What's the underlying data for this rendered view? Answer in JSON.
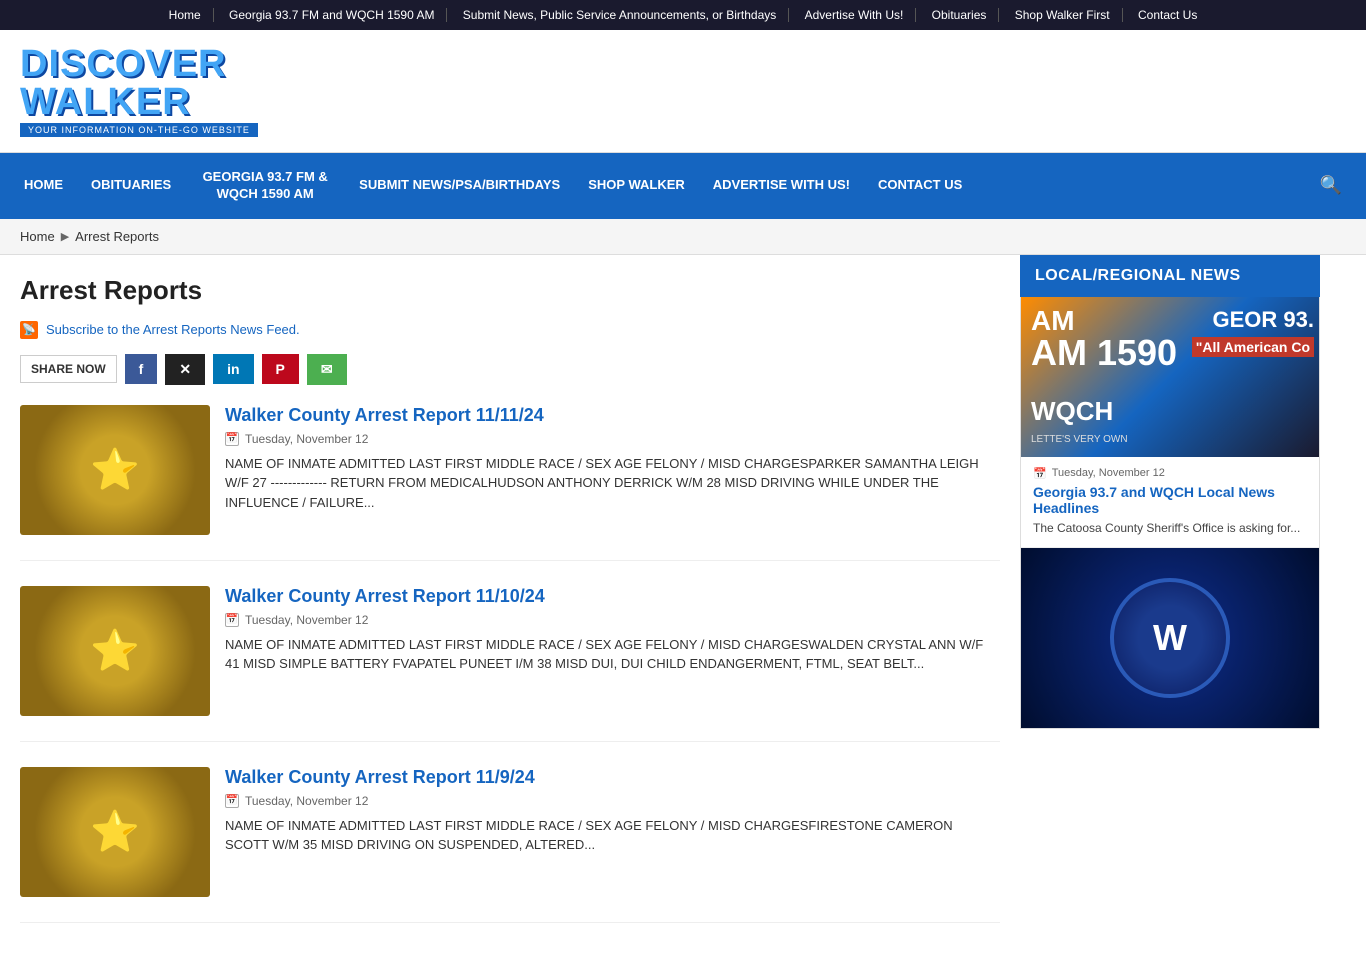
{
  "topnav": {
    "links": [
      {
        "label": "Home",
        "href": "#"
      },
      {
        "label": "Georgia 93.7 FM and WQCH 1590 AM",
        "href": "#"
      },
      {
        "label": "Submit News, Public Service Announcements, or Birthdays",
        "href": "#"
      },
      {
        "label": "Advertise With Us!",
        "href": "#"
      },
      {
        "label": "Obituaries",
        "href": "#"
      },
      {
        "label": "Shop Walker First",
        "href": "#"
      },
      {
        "label": "Contact Us",
        "href": "#"
      }
    ]
  },
  "header": {
    "logo_line1": "DISCOVER",
    "logo_line2": "WALKER",
    "subtitle": "YOUR INFORMATION ON-THE-GO WEBSITE"
  },
  "mainnav": {
    "items": [
      {
        "label": "HOME",
        "href": "#"
      },
      {
        "label": "OBITUARIES",
        "href": "#"
      },
      {
        "label": "GEORGIA 93.7 FM & WQCH 1590 AM",
        "href": "#"
      },
      {
        "label": "SUBMIT NEWS/PSA/BIRTHDAYS",
        "href": "#"
      },
      {
        "label": "SHOP WALKER",
        "href": "#"
      },
      {
        "label": "ADVERTISE WITH US!",
        "href": "#"
      },
      {
        "label": "CONTACT US",
        "href": "#"
      }
    ]
  },
  "breadcrumb": {
    "home": "Home",
    "current": "Arrest Reports"
  },
  "page": {
    "title": "Arrest Reports",
    "rss_text": "Subscribe to the Arrest Reports News Feed.",
    "share_label": "SHARE NOW"
  },
  "share": {
    "facebook": "f",
    "twitter": "✕",
    "linkedin": "in",
    "pinterest": "P",
    "email": "✉"
  },
  "articles": [
    {
      "title": "Walker County Arrest Report 11/11/24",
      "date": "Tuesday, November 12",
      "text": "NAME OF INMATE ADMITTED    LAST              FIRST                MIDDLE  RACE / SEX   AGE  FELONY / MISD    CHARGESPARKER  SAMANTHA  LEIGH  W/F  27  -------------    RETURN FROM MEDICALHUDSON  ANTHONY  DERRICK  W/M  28  MISD   DRIVING WHILE UNDER THE INFLUENCE / FAILURE..."
    },
    {
      "title": "Walker County Arrest Report 11/10/24",
      "date": "Tuesday, November 12",
      "text": "NAME OF INMATE ADMITTED    LAST              FIRST                MIDDLE  RACE / SEX   AGE  FELONY / MISD    CHARGESWALDEN  CRYSTAL  ANN  W/F  41  MISD    SIMPLE BATTERY  FVAPATEL  PUNEET    I/M  38  MISD   DUI, DUI CHILD ENDANGERMENT, FTML, SEAT BELT..."
    },
    {
      "title": "Walker County Arrest Report 11/9/24",
      "date": "Tuesday, November 12",
      "text": "NAME OF INMATE ADMITTED    LAST              FIRST                MIDDLE  RACE / SEX   AGE  FELONY / MISD    CHARGESFIRESTONE  CAMERON  SCOTT  W/M  35  MISD   DRIVING ON SUSPENDED, ALTERED..."
    }
  ],
  "sidebar": {
    "news_header": "LOCAL/REGIONAL NEWS",
    "radio_label": "AM 1590",
    "radio_label2": "WQCH",
    "radio_sub": "LETTE'S VERY OWN",
    "radio_right": "GEOR 93.",
    "radio_right2": "\"All American Co",
    "article1": {
      "date": "Tuesday, November 12",
      "title": "Georgia 93.7 and WQCH Local News Headlines",
      "text": "The Catoosa County Sheriff's Office is asking for..."
    },
    "walker_schools_letter": "W"
  }
}
